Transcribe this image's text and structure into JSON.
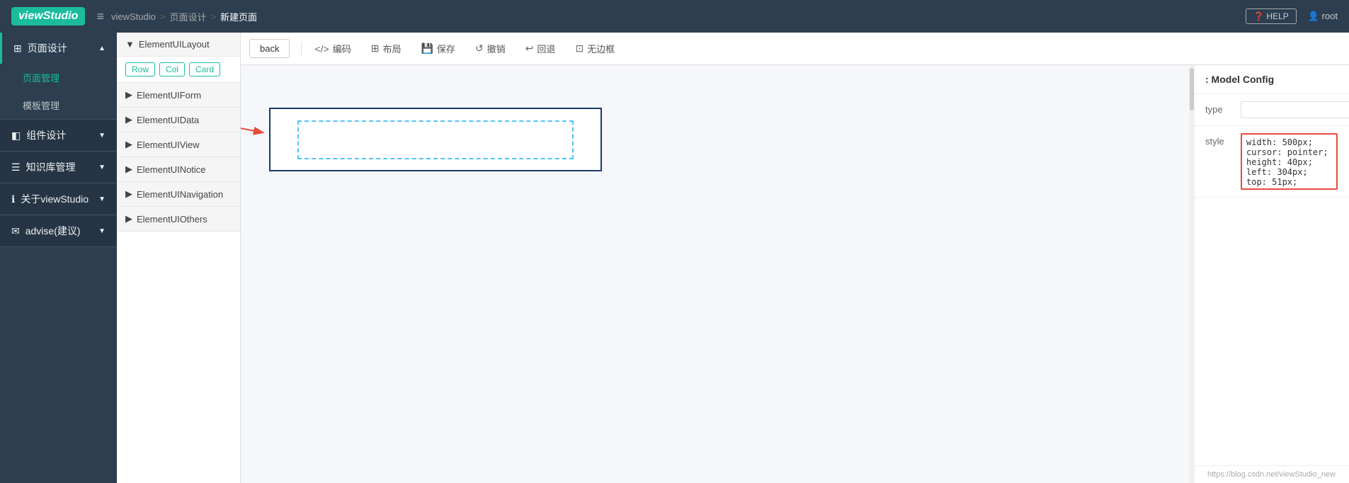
{
  "logo": {
    "text": "viewStudio"
  },
  "breadcrumb": {
    "items": [
      "viewStudio",
      "页面设计",
      "新建页面"
    ],
    "separator": ">"
  },
  "topRight": {
    "help": "HELP",
    "user": "root"
  },
  "sidebar": {
    "menuIcon": "≡",
    "sections": [
      {
        "label": "页面设计",
        "icon": "⊞",
        "active": true,
        "items": [
          "页面管理",
          "模板管理"
        ]
      },
      {
        "label": "组件设计",
        "icon": "◧",
        "active": false,
        "items": []
      },
      {
        "label": "知识库管理",
        "icon": "☰",
        "active": false,
        "items": []
      },
      {
        "label": "关于viewStudio",
        "icon": "ℹ",
        "active": false,
        "items": []
      },
      {
        "label": "advise(建议)",
        "icon": "✉",
        "active": false,
        "items": []
      }
    ]
  },
  "toolbar": {
    "back": "back",
    "buttons": [
      {
        "icon": "<>",
        "label": "编码"
      },
      {
        "icon": "⊞",
        "label": "布局"
      },
      {
        "icon": "💾",
        "label": "保存"
      },
      {
        "icon": "↺",
        "label": "撤销"
      },
      {
        "icon": "↩",
        "label": "回退"
      },
      {
        "icon": "⊡",
        "label": "无边框"
      }
    ]
  },
  "componentPanel": {
    "sections": [
      {
        "label": "ElementUILayout",
        "tags": [
          "Row",
          "Col",
          "Card"
        ]
      },
      {
        "label": "ElementUIForm",
        "tags": []
      },
      {
        "label": "ElementUIData",
        "tags": []
      },
      {
        "label": "ElementUIView",
        "tags": []
      },
      {
        "label": "ElementUINotice",
        "tags": []
      },
      {
        "label": "ElementUINavigation",
        "tags": []
      },
      {
        "label": "ElementUIOthers",
        "tags": []
      }
    ]
  },
  "configPanel": {
    "title": ": Model Config",
    "fields": [
      {
        "label": "type",
        "value": "",
        "type": "input"
      },
      {
        "label": "style",
        "value": "width: 500px; cursor: pointer; height: 40px; left: 304px; top: 51px;",
        "type": "textarea"
      }
    ],
    "footer": "https://blog.csdn.net/viewStudio_new"
  }
}
